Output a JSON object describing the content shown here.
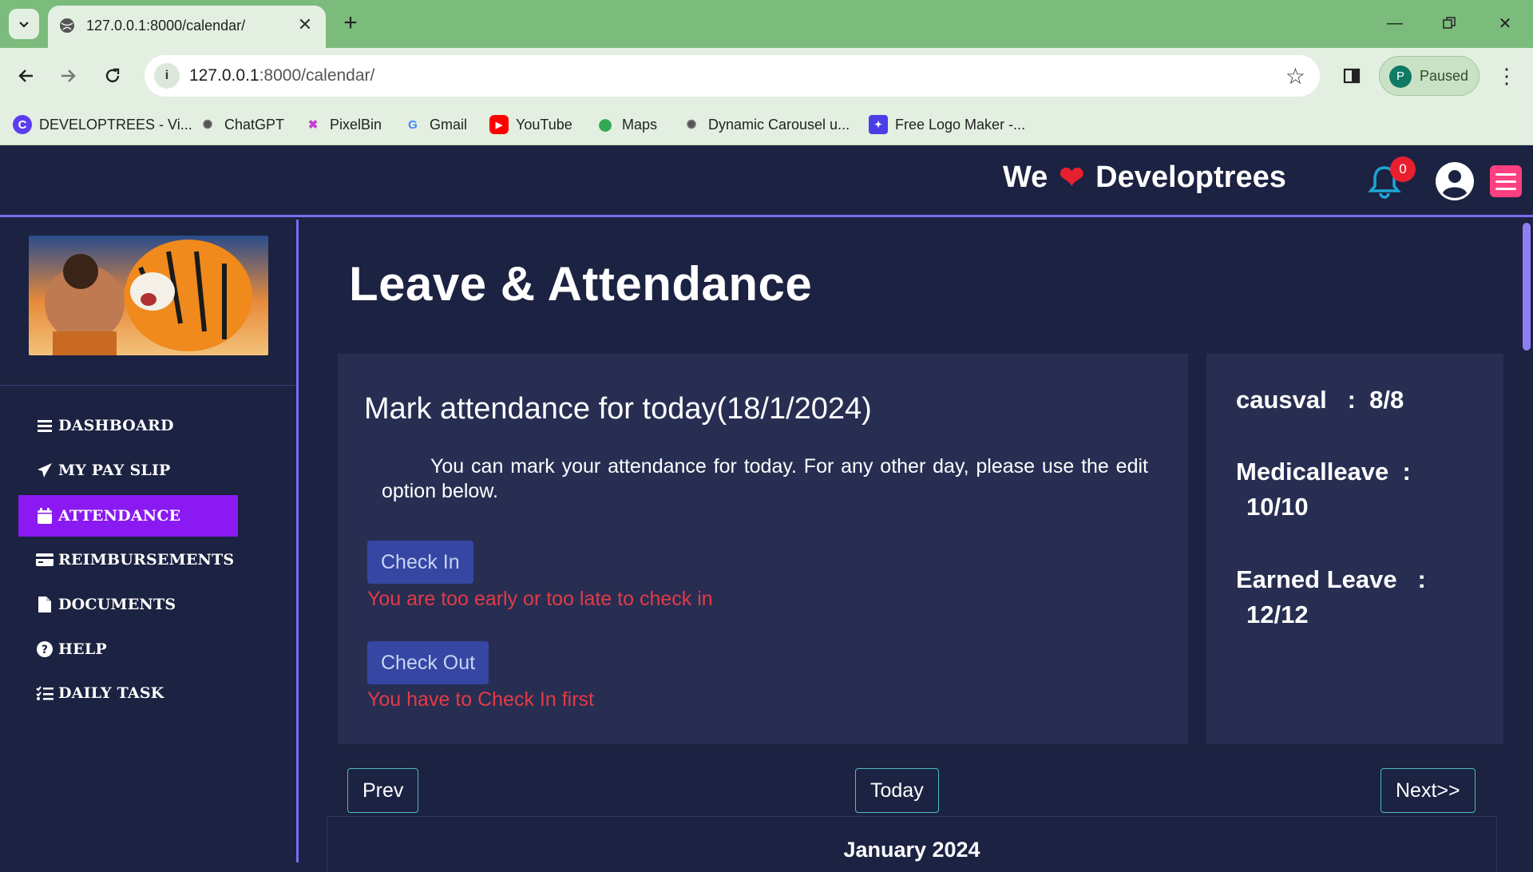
{
  "browser": {
    "tab_title": "127.0.0.1:8000/calendar/",
    "url_host": "127.0.0.1",
    "url_path": ":8000/calendar/",
    "profile_initial": "P",
    "profile_status": "Paused",
    "bookmarks": [
      {
        "label": "DEVELOPTREES - Vi...",
        "icon": "developtrees-favicon"
      },
      {
        "label": "ChatGPT",
        "icon": "chatgpt-favicon"
      },
      {
        "label": "PixelBin",
        "icon": "pixelbin-favicon"
      },
      {
        "label": "Gmail",
        "icon": "google-favicon"
      },
      {
        "label": "YouTube",
        "icon": "youtube-favicon"
      },
      {
        "label": "Maps",
        "icon": "maps-favicon"
      },
      {
        "label": "Dynamic Carousel u...",
        "icon": "chatgpt-favicon"
      },
      {
        "label": "Free Logo Maker -...",
        "icon": "logomaker-favicon"
      }
    ]
  },
  "header": {
    "brand_left": "We",
    "brand_right": "Developtrees",
    "notification_count": "0"
  },
  "sidebar": {
    "items": [
      {
        "label": "DASHBOARD",
        "icon": "bars-icon",
        "active": false
      },
      {
        "label": "MY PAY SLIP",
        "icon": "paper-plane-icon",
        "active": false
      },
      {
        "label": "ATTENDANCE",
        "icon": "calendar-icon",
        "active": true
      },
      {
        "label": "REIMBURSEMENTS",
        "icon": "credit-card-icon",
        "active": false
      },
      {
        "label": "DOCUMENTS",
        "icon": "file-icon",
        "active": false
      },
      {
        "label": "HELP",
        "icon": "question-circle-icon",
        "active": false
      },
      {
        "label": "DAILY TASK",
        "icon": "list-check-icon",
        "active": false
      }
    ]
  },
  "main": {
    "title": "Leave & Attendance",
    "attendance": {
      "heading": "Mark attendance for today(18/1/2024)",
      "description": "You can mark your attendance for today. For any other day, please use the edit option below.",
      "check_in_label": "Check In",
      "check_in_error": "You are too early or too late to check in",
      "check_out_label": "Check Out",
      "check_out_error": "You have to Check In first"
    },
    "leaves": {
      "causal": "causval   :  8/8",
      "medical_label": "Medicalleave  :",
      "medical_value": "10/10",
      "earned_label": "Earned Leave   :",
      "earned_value": "12/12"
    },
    "calendar": {
      "prev_label": "Prev",
      "today_label": "Today",
      "next_label": "Next>>",
      "month": "January 2024"
    }
  },
  "colors": {
    "accent": "#8a19f2",
    "border_accent": "#7b6cf0",
    "error": "#e33a47",
    "button": "#3547a3",
    "background": "#1c2241",
    "card": "#272e52"
  }
}
